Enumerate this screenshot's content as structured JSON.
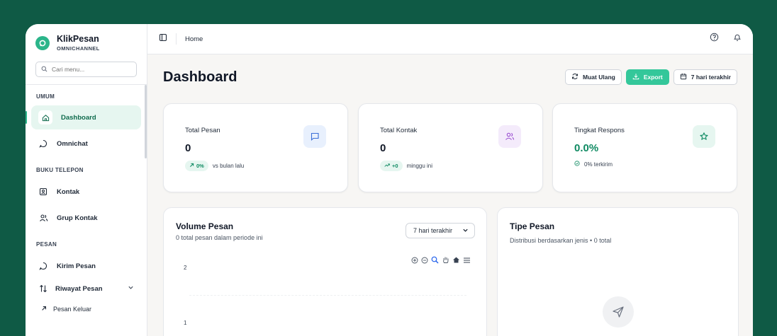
{
  "brand": {
    "name": "KlikPesan",
    "sub": "OMNICHANNEL"
  },
  "search": {
    "placeholder": "Cari menu..."
  },
  "sidebar": {
    "sections": {
      "umum": "UMUM",
      "buku": "BUKU TELEPON",
      "pesan": "PESAN"
    },
    "items": {
      "dashboard": "Dashboard",
      "omnichat": "Omnichat",
      "kontak": "Kontak",
      "grup": "Grup Kontak",
      "kirim": "Kirim Pesan",
      "riwayat": "Riwayat Pesan",
      "keluar": "Pesan Keluar"
    }
  },
  "topbar": {
    "breadcrumb": "Home"
  },
  "page": {
    "title": "Dashboard"
  },
  "actions": {
    "reload": "Muat Ulang",
    "export": "Export",
    "range": "7 hari terakhir"
  },
  "stats": [
    {
      "label": "Total Pesan",
      "value": "0",
      "badge": "0%",
      "note": "vs bulan lalu",
      "icon": "chat-icon"
    },
    {
      "label": "Total Kontak",
      "value": "0",
      "badge": "+0",
      "note": "minggu ini",
      "icon": "users-icon"
    },
    {
      "label": "Tingkat Respons",
      "value": "0.0%",
      "note": "0% terkirim",
      "icon": "star-icon"
    }
  ],
  "volume": {
    "title": "Volume Pesan",
    "subtitle": "0 total pesan dalam periode ini",
    "select": "7 hari terakhir",
    "ticks": [
      "2",
      "1"
    ]
  },
  "tipe": {
    "title": "Tipe Pesan",
    "subtitle": "Distribusi berdasarkan jenis • 0 total"
  },
  "colors": {
    "accent": "#34c79a",
    "brand": "#0f5a45"
  }
}
